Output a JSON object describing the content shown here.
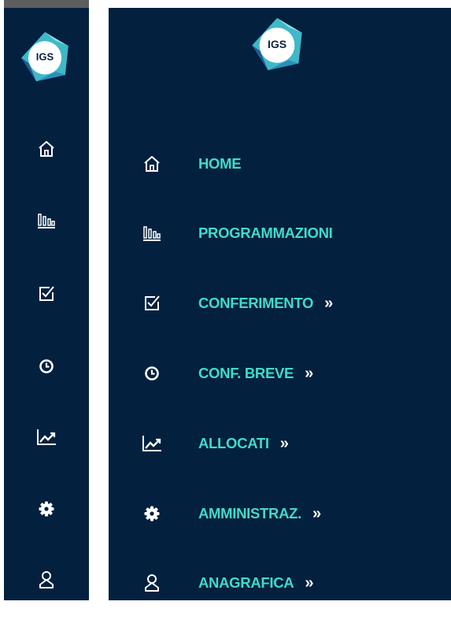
{
  "brand": {
    "logo_text": "IGS"
  },
  "colors": {
    "background": "#03203f",
    "label": "#41dbc8",
    "icon": "#ffffff"
  },
  "rail": {
    "items": [
      {
        "icon": "home-icon"
      },
      {
        "icon": "bar-chart-icon"
      },
      {
        "icon": "checkbox-icon"
      },
      {
        "icon": "clock-icon"
      },
      {
        "icon": "line-chart-icon"
      },
      {
        "icon": "gear-icon"
      },
      {
        "icon": "user-icon"
      }
    ]
  },
  "menu": {
    "arrow": "»",
    "items": [
      {
        "label": "HOME",
        "icon": "home-icon"
      },
      {
        "label": "PROGRAMMAZIONI",
        "icon": "bar-chart-icon"
      },
      {
        "label": "CONFERIMENTO",
        "icon": "checkbox-icon"
      },
      {
        "label": "CONF. BREVE",
        "icon": "clock-icon"
      },
      {
        "label": "ALLOCATI",
        "icon": "line-chart-icon"
      },
      {
        "label": "AMMINISTRAZ.",
        "icon": "gear-icon"
      },
      {
        "label": "ANAGRAFICA",
        "icon": "user-icon"
      }
    ]
  }
}
